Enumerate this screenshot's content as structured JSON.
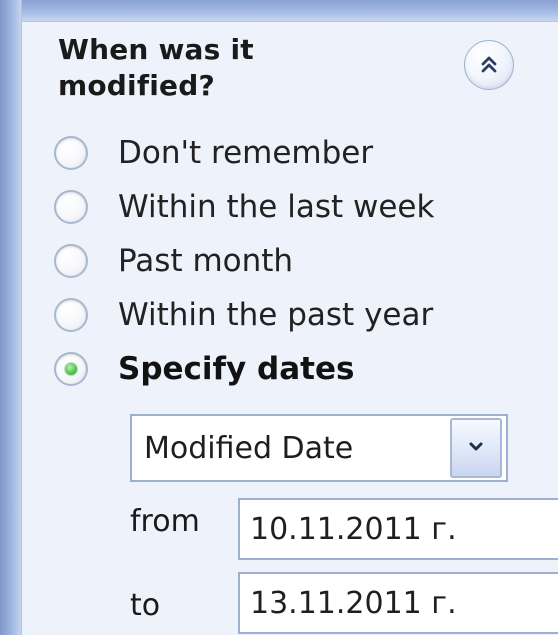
{
  "panel": {
    "title": "When was it modified?",
    "collapse_icon": "chevron-double-up-icon",
    "options": [
      {
        "label": "Don't remember",
        "checked": false
      },
      {
        "label": "Within the last week",
        "checked": false
      },
      {
        "label": "Past month",
        "checked": false
      },
      {
        "label": "Within the past year",
        "checked": false
      },
      {
        "label": "Specify dates",
        "checked": true
      }
    ],
    "date_type_select": {
      "value": "Modified Date",
      "dropdown_icon": "chevron-down-icon"
    },
    "date_range": {
      "from_label": "from",
      "from_value": "10.11.2011 г.",
      "to_label": "to",
      "to_value": "13.11.2011 г."
    }
  }
}
